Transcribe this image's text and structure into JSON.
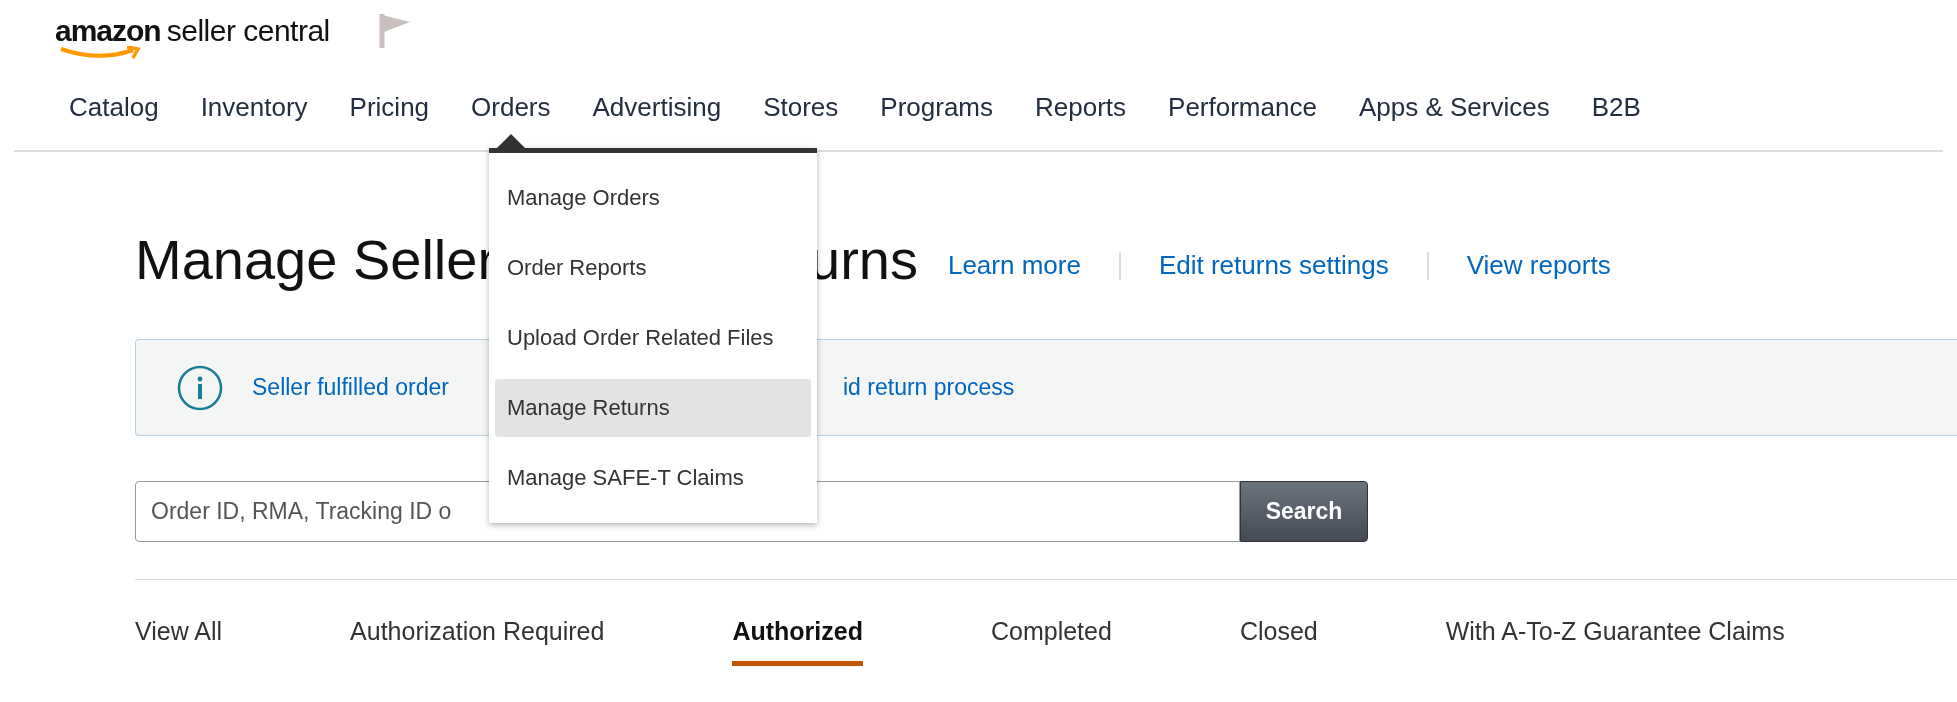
{
  "header": {
    "logo_brand": "amazon",
    "logo_product": "seller central"
  },
  "nav": [
    {
      "label": "Catalog",
      "selected": false
    },
    {
      "label": "Inventory",
      "selected": false
    },
    {
      "label": "Pricing",
      "selected": false
    },
    {
      "label": "Orders",
      "selected": true
    },
    {
      "label": "Advertising",
      "selected": false
    },
    {
      "label": "Stores",
      "selected": false
    },
    {
      "label": "Programs",
      "selected": false
    },
    {
      "label": "Reports",
      "selected": false
    },
    {
      "label": "Performance",
      "selected": false
    },
    {
      "label": "Apps & Services",
      "selected": false
    },
    {
      "label": "B2B",
      "selected": false
    }
  ],
  "dropdown": {
    "items": [
      {
        "label": "Manage Orders",
        "selected": false
      },
      {
        "label": "Order Reports",
        "selected": false
      },
      {
        "label": "Upload Order Related Files",
        "selected": false
      },
      {
        "label": "Manage Returns",
        "selected": true
      },
      {
        "label": "Manage SAFE-T Claims",
        "selected": false
      }
    ]
  },
  "page": {
    "title_start": "Manage Seller",
    "title_end": "urns",
    "links": [
      "Learn more",
      "Edit returns settings",
      "View reports"
    ]
  },
  "banner": {
    "text_start": "Seller fulfilled order",
    "text_end": "id return process"
  },
  "search": {
    "placeholder": "Order ID, RMA, Tracking ID o",
    "button": "Search"
  },
  "tabs": [
    {
      "label": "View All",
      "selected": false
    },
    {
      "label": "Authorization Required",
      "selected": false
    },
    {
      "label": "Authorized",
      "selected": true
    },
    {
      "label": "Completed",
      "selected": false
    },
    {
      "label": "Closed",
      "selected": false
    },
    {
      "label": "With A-To-Z Guarantee Claims",
      "selected": false
    }
  ]
}
